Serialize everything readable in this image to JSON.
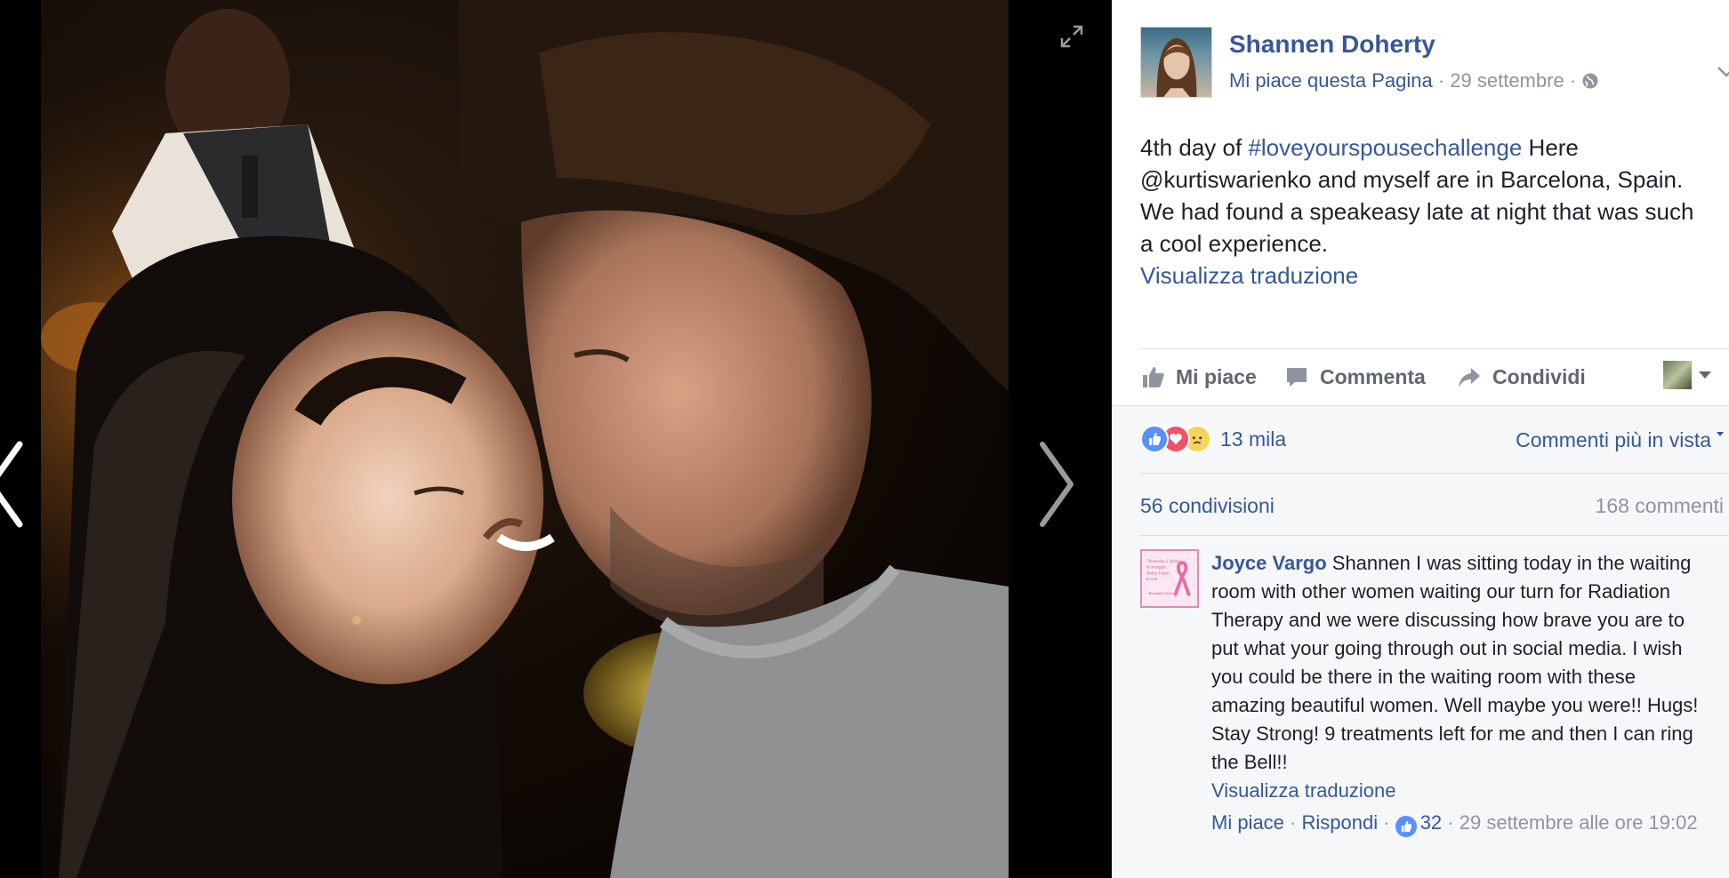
{
  "post": {
    "page_name": "Shannen Doherty",
    "like_page": "Mi piace questa Pagina",
    "date": "29 settembre",
    "text_before_hashtag": "4th day of ",
    "hashtag": "#loveyourspousechallenge",
    "text_after_hashtag": " Here @kurtiswarienko and myself are in Barcelona, Spain. We had found a speakeasy late at night that was such a cool experience.",
    "see_translation": "Visualizza traduzione"
  },
  "actions": {
    "like": "Mi piace",
    "comment": "Commenta",
    "share": "Condividi"
  },
  "reactions": {
    "count": "13 mila",
    "types": [
      "like",
      "love",
      "sad"
    ],
    "sort_label": "Commenti più in vista"
  },
  "stats": {
    "shares": "56 condivisioni",
    "comments": "168 commenti"
  },
  "comments": [
    {
      "author": "Joyce Vargo",
      "text": "Shannen I was sitting today in the waiting room with other women waiting our turn for Radiation Therapy and we were discussing how brave you are to put what your going through out in social media. I wish you could be there in the waiting room with these amazing beautiful women. Well maybe you were!! Hugs! Stay Strong! 9 treatments left for me and then I can ring the Bell!!",
      "see_translation": "Visualizza traduzione",
      "like_label": "Mi piace",
      "reply_label": "Rispondi",
      "likes": "32",
      "timestamp": "29 settembre alle ore 19:02",
      "avatar_text": "\"Yesterday I dared to struggle. Today I dare to win.\" ~ Bernadette Devlin"
    }
  ],
  "colors": {
    "link": "#365899",
    "meta": "#90949c",
    "like_blue": "#5890ff",
    "love_red": "#f25268",
    "sad_yellow": "#f7d35c"
  },
  "icons": [
    "expand-icon",
    "chevron-left-icon",
    "chevron-right-icon",
    "globe-icon",
    "chevron-down-icon",
    "thumbs-up-icon",
    "comment-icon",
    "share-icon",
    "caret-down-icon"
  ]
}
